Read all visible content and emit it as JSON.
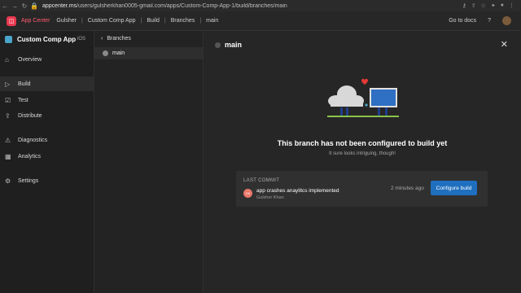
{
  "browser": {
    "url_host": "appcenter.ms",
    "url_path": "/users/gulsherkhan0005-gmail.com/apps/Custom-Comp-App-1/build/branches/main"
  },
  "header": {
    "brand": "App Center",
    "breadcrumbs": [
      "Gulsher",
      "Custom Comp App",
      "Build",
      "Branches",
      "main"
    ],
    "docs_link": "Go to docs",
    "help": "?"
  },
  "sidebar": {
    "app_name": "Custom Comp App",
    "platform": "iOS",
    "items": [
      {
        "label": "Overview",
        "icon": "⌂"
      },
      {
        "label": "Build",
        "icon": "▷"
      },
      {
        "label": "Test",
        "icon": "☑"
      },
      {
        "label": "Distribute",
        "icon": "⇪"
      },
      {
        "label": "Diagnostics",
        "icon": "⚠"
      },
      {
        "label": "Analytics",
        "icon": "▦"
      },
      {
        "label": "Settings",
        "icon": "⚙"
      }
    ]
  },
  "branches": {
    "heading": "Branches",
    "back": "‹",
    "items": [
      {
        "name": "main"
      }
    ]
  },
  "main": {
    "branch_name": "main",
    "close": "✕",
    "empty_title": "This branch has not been configured to build yet",
    "empty_subtitle": "It sure looks intriguing, though!",
    "last_commit": {
      "label": "LAST COMMIT",
      "avatar_initials": "GK",
      "message": "app crashes anaylitcs implemented",
      "author": "Gulsher Khan",
      "time": "2 minutes ago",
      "button": "Configure build"
    }
  },
  "colors": {
    "accent": "#1f6fbf",
    "brand": "#e8384f"
  }
}
